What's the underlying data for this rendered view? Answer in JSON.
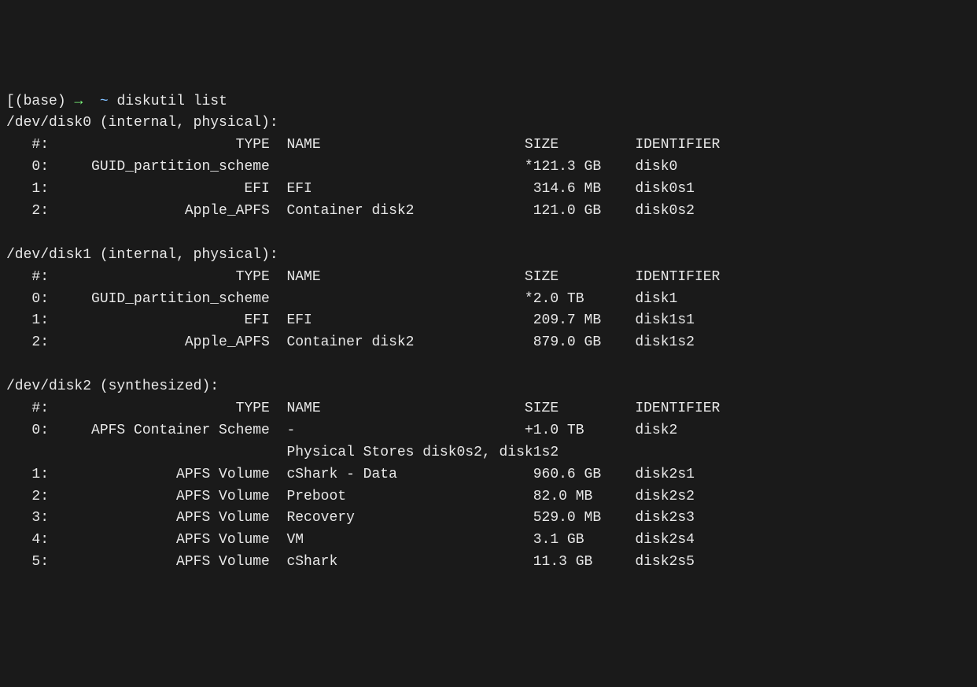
{
  "prompt": {
    "bracket_open": "[",
    "env": "(base)",
    "arrow": "→",
    "tilde": "~",
    "command": "diskutil list"
  },
  "disks": [
    {
      "header": "/dev/disk0 (internal, physical):",
      "columns": {
        "idx": "   #:",
        "type": "                      TYPE",
        "name": "NAME",
        "size": "SIZE",
        "identifier": "IDENTIFIER"
      },
      "rows": [
        {
          "idx": "   0:",
          "type": "     GUID_partition_scheme",
          "name": "",
          "size": "*121.3 GB",
          "identifier": "disk0"
        },
        {
          "idx": "   1:",
          "type": "                       EFI",
          "name": "EFI",
          "size": " 314.6 MB",
          "identifier": "disk0s1"
        },
        {
          "idx": "   2:",
          "type": "                Apple_APFS",
          "name": "Container disk2",
          "size": " 121.0 GB",
          "identifier": "disk0s2"
        }
      ]
    },
    {
      "header": "/dev/disk1 (internal, physical):",
      "columns": {
        "idx": "   #:",
        "type": "                      TYPE",
        "name": "NAME",
        "size": "SIZE",
        "identifier": "IDENTIFIER"
      },
      "rows": [
        {
          "idx": "   0:",
          "type": "     GUID_partition_scheme",
          "name": "",
          "size": "*2.0 TB",
          "identifier": "disk1"
        },
        {
          "idx": "   1:",
          "type": "                       EFI",
          "name": "EFI",
          "size": " 209.7 MB",
          "identifier": "disk1s1"
        },
        {
          "idx": "   2:",
          "type": "                Apple_APFS",
          "name": "Container disk2",
          "size": " 879.0 GB",
          "identifier": "disk1s2"
        }
      ]
    },
    {
      "header": "/dev/disk2 (synthesized):",
      "columns": {
        "idx": "   #:",
        "type": "                      TYPE",
        "name": "NAME",
        "size": "SIZE",
        "identifier": "IDENTIFIER"
      },
      "rows": [
        {
          "idx": "   0:",
          "type": "     APFS Container Scheme",
          "name": "-",
          "size": "+1.0 TB",
          "identifier": "disk2"
        },
        {
          "idx": "",
          "type": "                          ",
          "name": "Physical Stores disk0s2, disk1s2",
          "size": "",
          "identifier": ""
        },
        {
          "idx": "   1:",
          "type": "               APFS Volume",
          "name": "cShark - Data",
          "size": " 960.6 GB",
          "identifier": "disk2s1"
        },
        {
          "idx": "   2:",
          "type": "               APFS Volume",
          "name": "Preboot",
          "size": " 82.0 MB",
          "identifier": "disk2s2"
        },
        {
          "idx": "   3:",
          "type": "               APFS Volume",
          "name": "Recovery",
          "size": " 529.0 MB",
          "identifier": "disk2s3"
        },
        {
          "idx": "   4:",
          "type": "               APFS Volume",
          "name": "VM",
          "size": " 3.1 GB",
          "identifier": "disk2s4"
        },
        {
          "idx": "   5:",
          "type": "               APFS Volume",
          "name": "cShark",
          "size": " 11.3 GB",
          "identifier": "disk2s5"
        }
      ]
    }
  ],
  "col_widths": {
    "idx": 5,
    "type": 27,
    "name": 28,
    "size": 11,
    "identifier": 12
  }
}
